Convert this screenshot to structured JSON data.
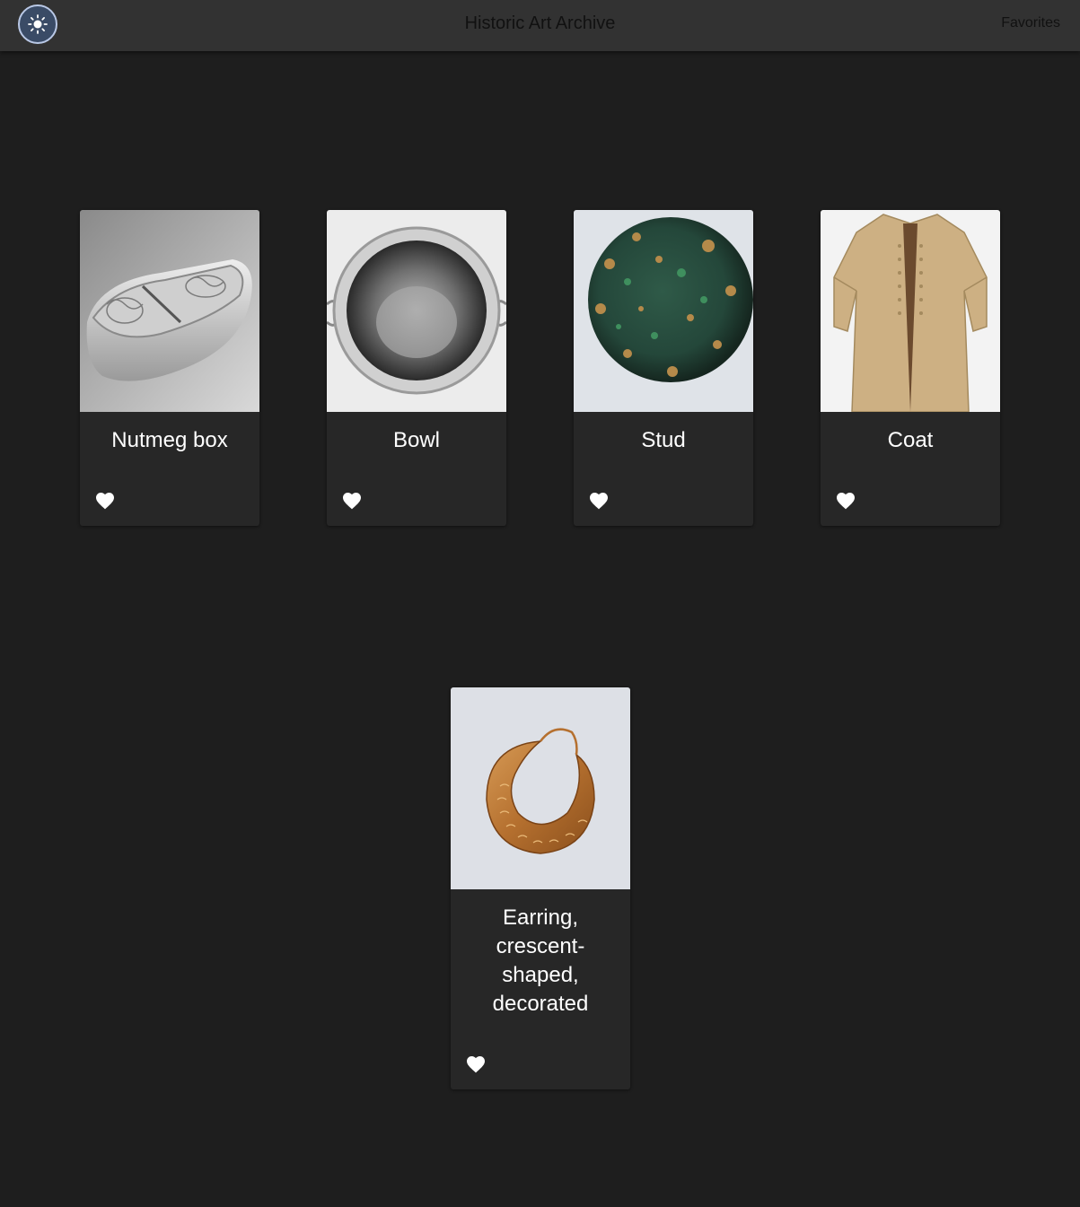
{
  "header": {
    "title": "Historic Art Archive",
    "favorites_label": "Favorites",
    "theme_icon": "sun-icon"
  },
  "colors": {
    "background": "#1e1e1e",
    "topbar": "#323232",
    "card": "#272727",
    "theme_button": "#3a4b66"
  },
  "items": [
    {
      "name": "Nutmeg box",
      "icon": "heart-icon"
    },
    {
      "name": "Bowl",
      "icon": "heart-icon"
    },
    {
      "name": "Stud",
      "icon": "heart-icon"
    },
    {
      "name": "Coat",
      "icon": "heart-icon"
    },
    {
      "name": "Earring, crescent-shaped, decorated",
      "icon": "heart-icon"
    }
  ]
}
